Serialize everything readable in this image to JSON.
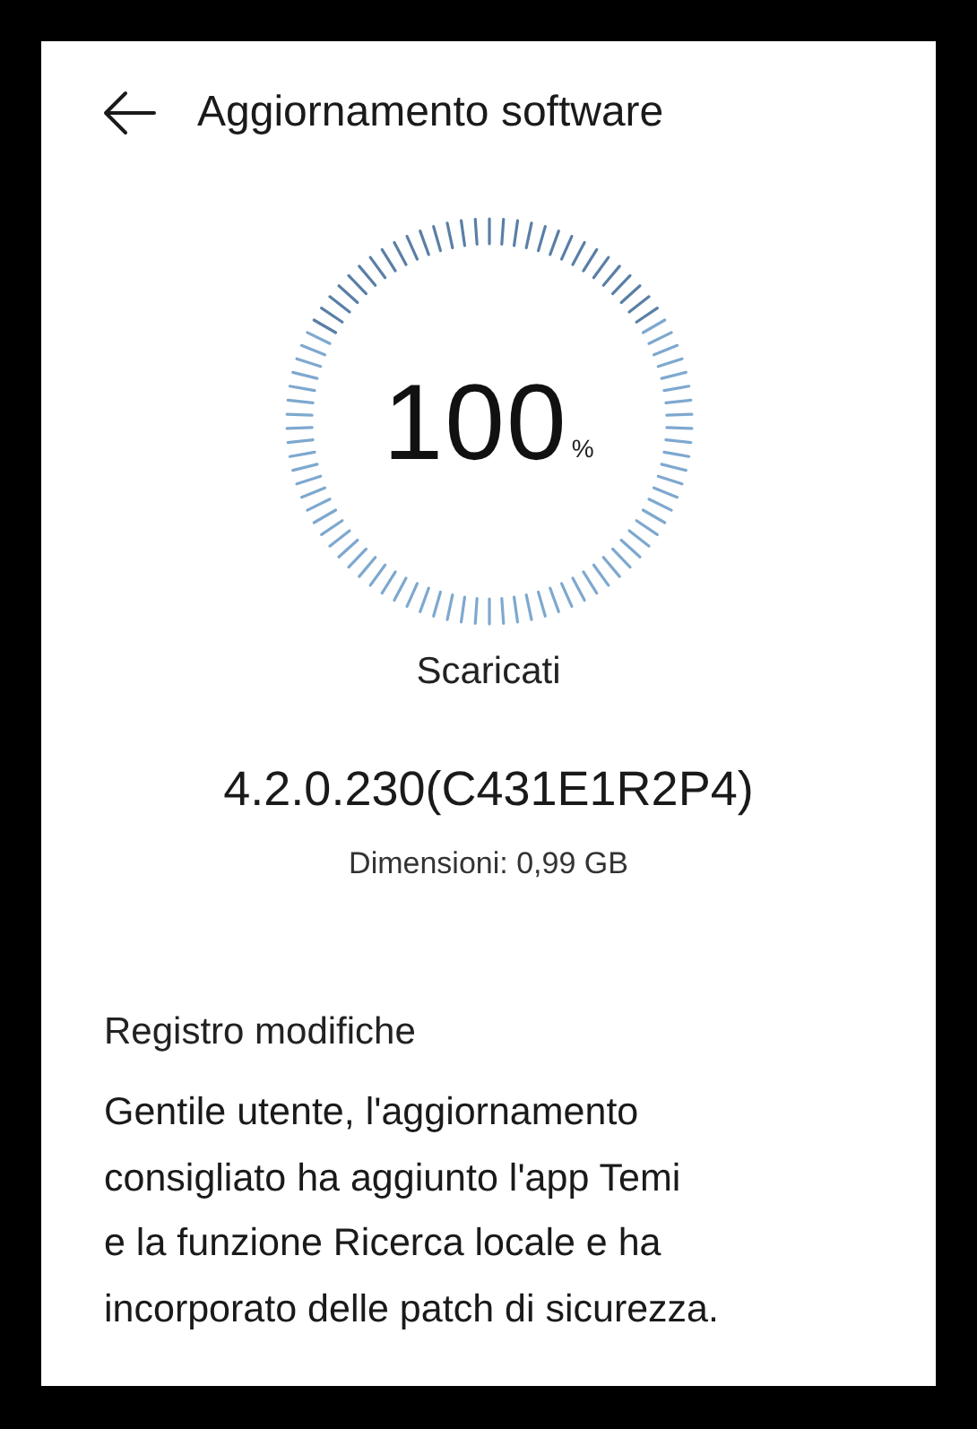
{
  "header": {
    "title": "Aggiornamento software"
  },
  "progress": {
    "level": 1,
    "value": "100",
    "unit": "%",
    "status": "Scaricati"
  },
  "version": "4.2.0.230(C431E1R2P4)",
  "size": "Dimensioni: 0,99 GB",
  "changelog": {
    "title": "Registro modifiche",
    "lines": [
      "Gentile utente, l'aggiornamento",
      "consigliato ha aggiunto l'app Temi",
      "e la funzione Ricerca locale e ha",
      "incorporato delle patch di sicurezza."
    ]
  }
}
